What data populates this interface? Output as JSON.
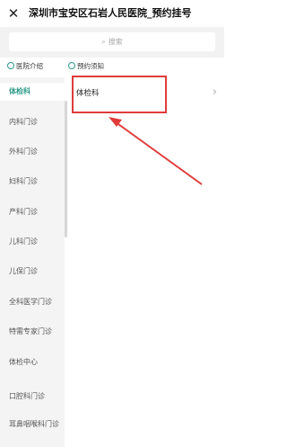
{
  "header": {
    "close_icon": "close-icon",
    "title": "深圳市宝安区石岩人民医院_预约挂号"
  },
  "search": {
    "icon": "search-icon",
    "placeholder": "搜索"
  },
  "links": [
    {
      "icon": "circle-icon",
      "label": "医院介绍"
    },
    {
      "icon": "circle-icon",
      "label": "预约须知"
    }
  ],
  "sidebar": {
    "items": [
      {
        "label": "体检科",
        "active": true
      },
      {
        "label": "内科门诊"
      },
      {
        "label": "外科门诊"
      },
      {
        "label": "妇科门诊"
      },
      {
        "label": "产科门诊"
      },
      {
        "label": "儿科门诊"
      },
      {
        "label": "儿保门诊"
      },
      {
        "label": "全科医学门诊"
      },
      {
        "label": "特需专家门诊"
      },
      {
        "label": "体检中心"
      },
      {
        "label": "口腔科门诊"
      },
      {
        "label": "耳鼻咽喉科门诊"
      }
    ]
  },
  "content": {
    "departments": [
      {
        "label": "体检科"
      }
    ],
    "chevron_icon": "chevron-right-icon"
  },
  "annotation": {
    "color": "#e03c3c"
  },
  "colors": {
    "accent": "#2e9b8a",
    "annotation": "#e03c3c"
  }
}
